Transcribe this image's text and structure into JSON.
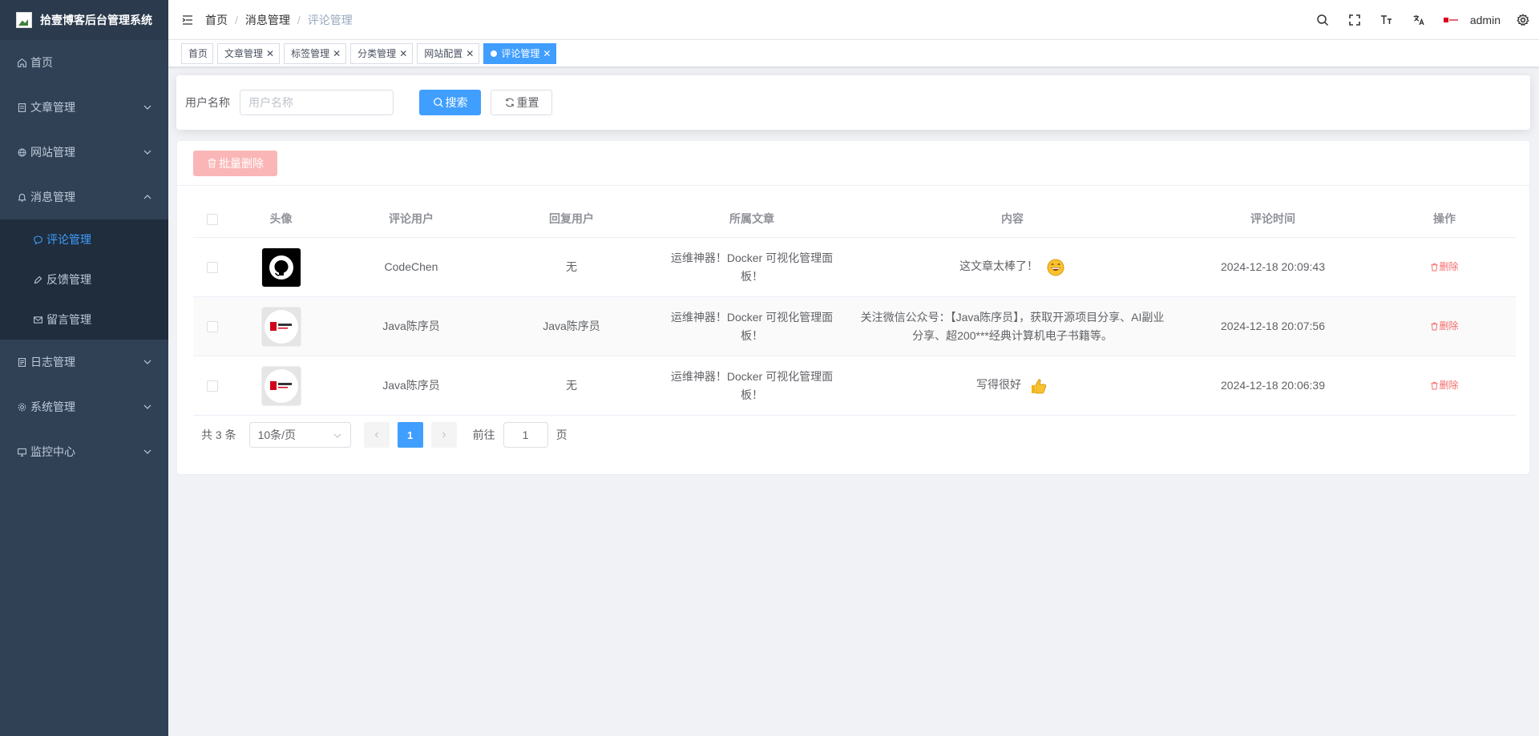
{
  "app": {
    "title": "拾壹博客后台管理系统"
  },
  "sidebar": {
    "items": [
      {
        "label": "首页",
        "icon": "home-icon"
      },
      {
        "label": "文章管理",
        "icon": "document-icon"
      },
      {
        "label": "网站管理",
        "icon": "website-icon"
      },
      {
        "label": "消息管理",
        "icon": "bell-icon"
      },
      {
        "label": "日志管理",
        "icon": "log-icon"
      },
      {
        "label": "系统管理",
        "icon": "gear-icon"
      },
      {
        "label": "监控中心",
        "icon": "monitor-icon"
      }
    ],
    "message_children": [
      {
        "label": "评论管理",
        "icon": "comment-icon"
      },
      {
        "label": "反馈管理",
        "icon": "feedback-icon"
      },
      {
        "label": "留言管理",
        "icon": "mail-icon"
      }
    ]
  },
  "header": {
    "breadcrumb": [
      "首页",
      "消息管理",
      "评论管理"
    ],
    "separator": "/",
    "username": "admin"
  },
  "tags": [
    {
      "label": "首页",
      "closable": false
    },
    {
      "label": "文章管理",
      "closable": true
    },
    {
      "label": "标签管理",
      "closable": true
    },
    {
      "label": "分类管理",
      "closable": true
    },
    {
      "label": "网站配置",
      "closable": true
    },
    {
      "label": "评论管理",
      "closable": true,
      "active": true
    }
  ],
  "search": {
    "label": "用户名称",
    "placeholder": "用户名称",
    "search_btn": "搜索",
    "reset_btn": "重置"
  },
  "toolbar": {
    "batch_delete": "批量删除"
  },
  "table": {
    "columns": [
      "头像",
      "评论用户",
      "回复用户",
      "所属文章",
      "内容",
      "评论时间",
      "操作"
    ],
    "rows": [
      {
        "avatar": "github-avatar",
        "user": "CodeChen",
        "reply": "无",
        "article": "运维神器！Docker 可视化管理面板！",
        "content": "这文章太棒了！",
        "emoji": "grin-emoji",
        "time": "2024-12-18 20:09:43",
        "op": "删除"
      },
      {
        "avatar": "java-avatar",
        "user": "Java陈序员",
        "reply": "Java陈序员",
        "article": "运维神器！Docker 可视化管理面板！",
        "content": "关注微信公众号：【Java陈序员】，获取开源项目分享、AI副业分享、超200***经典计算机电子书籍等。",
        "emoji": "",
        "time": "2024-12-18 20:07:56",
        "op": "删除"
      },
      {
        "avatar": "java-avatar",
        "user": "Java陈序员",
        "reply": "无",
        "article": "运维神器！Docker 可视化管理面板！",
        "content": "写得很好",
        "emoji": "thumbs-up-emoji",
        "time": "2024-12-18 20:06:39",
        "op": "删除"
      }
    ]
  },
  "pagination": {
    "total": "共 3 条",
    "page_size": "10条/页",
    "current": "1",
    "goto_label": "前往",
    "goto_value": "1",
    "page_unit": "页"
  },
  "colors": {
    "primary": "#409eff",
    "danger": "#f56c6c",
    "sidebar_bg": "#304156"
  }
}
